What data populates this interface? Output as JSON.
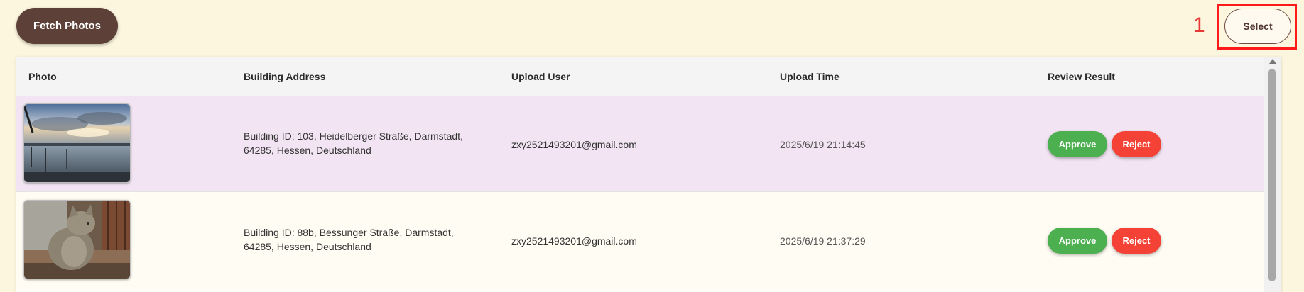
{
  "toolbar": {
    "fetch_label": "Fetch Photos",
    "select_label": "Select",
    "annotation_number": "1"
  },
  "table": {
    "headers": {
      "photo": "Photo",
      "address": "Building Address",
      "user": "Upload User",
      "time": "Upload Time",
      "review": "Review Result"
    },
    "rows": [
      {
        "photo_icon": "lake-photo",
        "address_line1": "Building ID: 103, Heidelberger Straße, Darmstadt,",
        "address_line2": "64285, Hessen, Deutschland",
        "user": "zxy2521493201@gmail.com",
        "time": "2025/6/19 21:14:45",
        "approve_label": "Approve",
        "reject_label": "Reject"
      },
      {
        "photo_icon": "cat-photo",
        "address_line1": "Building ID: 88b, Bessunger Straße, Darmstadt,",
        "address_line2": "64285, Hessen, Deutschland",
        "user": "zxy2521493201@gmail.com",
        "time": "2025/6/19 21:37:29",
        "approve_label": "Approve",
        "reject_label": "Reject"
      }
    ]
  },
  "colors": {
    "page_bg": "#fdf6df",
    "fetch_button": "#5d4037",
    "approve": "#4caf50",
    "reject": "#f44336",
    "highlight_row": "#f2e4f3",
    "annotation": "#ff1a1a"
  }
}
